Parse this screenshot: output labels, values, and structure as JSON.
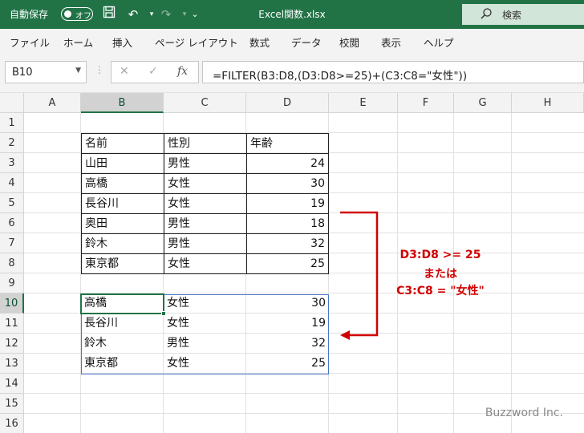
{
  "titlebar": {
    "autosave_label": "自動保存",
    "autosave_state": "オフ",
    "filename": "Excel関数.xlsx",
    "search_label": "検索",
    "accent": "#217346"
  },
  "ribbon": {
    "tabs": [
      "ファイル",
      "ホーム",
      "挿入",
      "ページ レイアウト",
      "数式",
      "データ",
      "校閲",
      "表示",
      "ヘルプ"
    ]
  },
  "formula_bar": {
    "name_box": "B10",
    "fx_label": "fx",
    "formula": "=FILTER(B3:D8,(D3:D8>=25)+(C3:C8=\"女性\"))"
  },
  "grid": {
    "columns": [
      "A",
      "B",
      "C",
      "D",
      "E",
      "F",
      "G",
      "H"
    ],
    "rows": [
      "1",
      "2",
      "3",
      "4",
      "5",
      "6",
      "7",
      "8",
      "9",
      "10",
      "11",
      "12",
      "13",
      "14",
      "15",
      "16"
    ],
    "selected_column": "B",
    "selected_row": "10"
  },
  "source_table": {
    "headers": [
      "名前",
      "性別",
      "年齢"
    ],
    "rows": [
      [
        "山田",
        "男性",
        "24"
      ],
      [
        "高橋",
        "女性",
        "30"
      ],
      [
        "長谷川",
        "女性",
        "19"
      ],
      [
        "奥田",
        "男性",
        "18"
      ],
      [
        "鈴木",
        "男性",
        "32"
      ],
      [
        "東京都",
        "女性",
        "25"
      ]
    ]
  },
  "result_table": {
    "rows": [
      [
        "高橋",
        "女性",
        "30"
      ],
      [
        "長谷川",
        "女性",
        "19"
      ],
      [
        "鈴木",
        "男性",
        "32"
      ],
      [
        "東京都",
        "女性",
        "25"
      ]
    ]
  },
  "annotation": {
    "line1": "D3:D8 >= 25",
    "line2": "または",
    "line3": "C3:C8 = \"女性\"",
    "color": "#d00000"
  },
  "watermark": "Buzzword Inc."
}
